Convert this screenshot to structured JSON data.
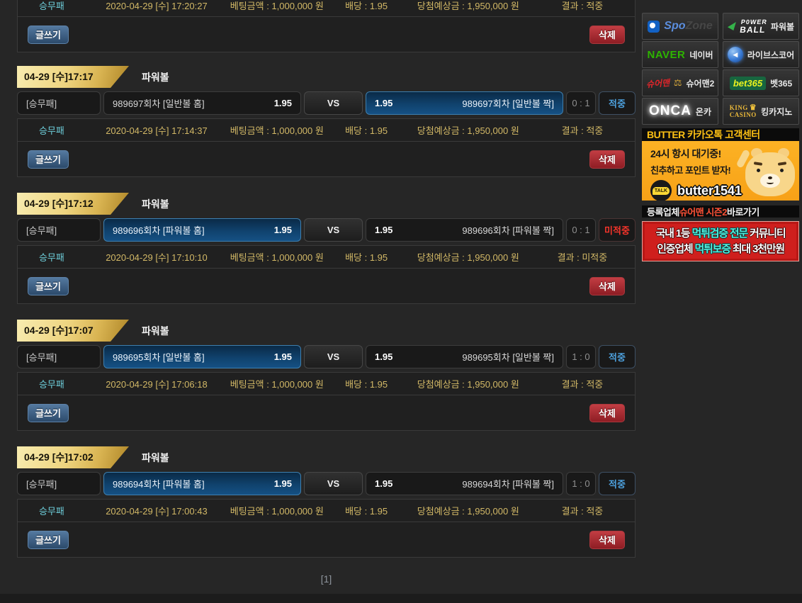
{
  "page": {
    "vs_label": "VS",
    "write_button": "글쓰기",
    "delete_button": "삭제",
    "pagination": "[1]"
  },
  "colors": {
    "hit": "#4da0dd",
    "miss": "#f5342a",
    "gold_text": "#d2b866",
    "cyan_text": "#6ecfdb",
    "selected_box": "#155084",
    "ribbon_gold": "#eed47f"
  },
  "records": [
    {
      "d_type": "승무패",
      "d_datetime": "2020-04-29 [수] 17:20:27",
      "d_bet": "베팅금액 : 1,000,000 원",
      "d_odds": "배당 : 1.95",
      "d_expected": "당첨예상금 : 1,950,000 원",
      "d_result": "결과 : 적중"
    },
    {
      "ribbon": "04-29 [수]17:17",
      "category": "파워볼",
      "bet_label": "[승무패]",
      "home_name": "989697회차 [일반볼 홈]",
      "home_odds": "1.95",
      "away_odds": "1.95",
      "away_name": "989697회차 [일반볼 짝]",
      "selected": "away",
      "score": "0 : 1",
      "result": "적중",
      "d_type": "승무패",
      "d_datetime": "2020-04-29 [수] 17:14:37",
      "d_bet": "베팅금액 : 1,000,000 원",
      "d_odds": "배당 : 1.95",
      "d_expected": "당첨예상금 : 1,950,000 원",
      "d_result": "결과 : 적중"
    },
    {
      "ribbon": "04-29 [수]17:12",
      "category": "파워볼",
      "bet_label": "[승무패]",
      "home_name": "989696회차 [파워볼 홈]",
      "home_odds": "1.95",
      "away_odds": "1.95",
      "away_name": "989696회차 [파워볼 짝]",
      "selected": "home",
      "score": "0 : 1",
      "result": "미적중",
      "d_type": "승무패",
      "d_datetime": "2020-04-29 [수] 17:10:10",
      "d_bet": "베팅금액 : 1,000,000 원",
      "d_odds": "배당 : 1.95",
      "d_expected": "당첨예상금 : 1,950,000 원",
      "d_result": "결과 : 미적중"
    },
    {
      "ribbon": "04-29 [수]17:07",
      "category": "파워볼",
      "bet_label": "[승무패]",
      "home_name": "989695회차 [일반볼 홈]",
      "home_odds": "1.95",
      "away_odds": "1.95",
      "away_name": "989695회차 [일반볼 짝]",
      "selected": "home",
      "score": "1 : 0",
      "result": "적중",
      "d_type": "승무패",
      "d_datetime": "2020-04-29 [수] 17:06:18",
      "d_bet": "베팅금액 : 1,000,000 원",
      "d_odds": "배당 : 1.95",
      "d_expected": "당첨예상금 : 1,950,000 원",
      "d_result": "결과 : 적중"
    },
    {
      "ribbon": "04-29 [수]17:02",
      "category": "파워볼",
      "bet_label": "[승무패]",
      "home_name": "989694회차 [파워볼 홈]",
      "home_odds": "1.95",
      "away_odds": "1.95",
      "away_name": "989694회차 [파워볼 짝]",
      "selected": "home",
      "score": "1 : 0",
      "result": "적중",
      "d_type": "승무패",
      "d_datetime": "2020-04-29 [수] 17:00:43",
      "d_bet": "베팅금액 : 1,000,000 원",
      "d_odds": "배당 : 1.95",
      "d_expected": "당첨예상금 : 1,950,000 원",
      "d_result": "결과 : 적중"
    }
  ],
  "sidebar": {
    "banners": {
      "spozone": {
        "logo1": "Spo",
        "logo2": "Zone",
        "label": ""
      },
      "powerball": {
        "logo1": "P0WER",
        "logo2": "BALL",
        "label": "파워볼"
      },
      "naver": {
        "logo": "NAVER",
        "label": "네이버"
      },
      "livescore": {
        "icon": "◀",
        "label": "라이브스코어"
      },
      "sureman2": {
        "logo": "슈어맨",
        "scale": "⚖",
        "label": "슈어맨2"
      },
      "bet365": {
        "logo": "bet365",
        "label": "벳365"
      },
      "onca": {
        "logo": "ONCA",
        "label": "온카"
      },
      "kingcasino": {
        "logo1": "KING",
        "crown": "♛",
        "logo2": "CASINO",
        "label": "킹카지노"
      }
    },
    "butter_title": "BUTTER 카카오톡 고객센터",
    "kakao": {
      "line1": "24시 항시 대기중!",
      "line2": "친추하고 포인트 받자!",
      "talk": "TALK",
      "id": "butter1541"
    },
    "sureman_bar": {
      "pre": "등록업체 ",
      "em": "슈어맨 시즌2",
      "post": " 바로가기"
    },
    "red_banner": {
      "l1a": "국내 1등 ",
      "l1b": "먹튀검증 전문",
      "l1c": " 커뮤니티",
      "l2a": "인증업체 ",
      "l2b": "먹튀보증",
      "l2c": " 최대 3천만원"
    }
  }
}
